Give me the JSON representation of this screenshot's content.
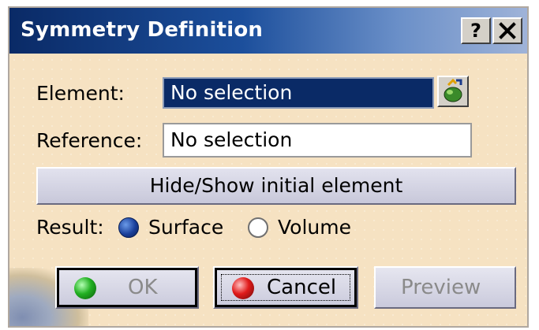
{
  "dialog": {
    "title": "Symmetry Definition",
    "help_label": "?",
    "close_label": "✕"
  },
  "element": {
    "label": "Element:",
    "value": "No selection"
  },
  "reference": {
    "label": "Reference:",
    "value": "No selection"
  },
  "hide_show_button": "Hide/Show initial element",
  "result": {
    "label": "Result:",
    "options": [
      {
        "label": "Surface",
        "selected": true
      },
      {
        "label": "Volume",
        "selected": false
      }
    ]
  },
  "actions": {
    "ok_label": "OK",
    "cancel_label": "Cancel",
    "preview_label": "Preview"
  },
  "colors": {
    "title_bar": "#0a2a66",
    "dialog_bg": "#f6e2c2",
    "selected_field": "#0a2a66"
  },
  "icons": {
    "selection_mode": "selection-mode-icon",
    "ok": "green-ball-icon",
    "cancel": "red-ball-icon"
  }
}
